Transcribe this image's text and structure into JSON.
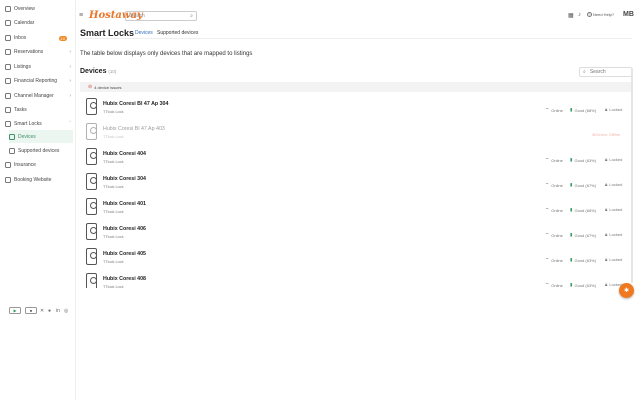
{
  "sidebar": {
    "items": [
      {
        "label": "Overview",
        "icon": "grid-icon"
      },
      {
        "label": "Calendar",
        "icon": "calendar-icon"
      },
      {
        "label": "Inbox",
        "icon": "inbox-icon",
        "badge": "10"
      },
      {
        "label": "Reservations",
        "icon": "reservations-icon"
      },
      {
        "label": "Listings",
        "icon": "listings-icon"
      },
      {
        "label": "Financial Reporting",
        "icon": "finance-icon"
      },
      {
        "label": "Channel Manager",
        "icon": "channel-icon"
      },
      {
        "label": "Tasks",
        "icon": "tasks-icon"
      },
      {
        "label": "Smart Locks",
        "icon": "lock-icon"
      },
      {
        "label": "Devices",
        "icon": "devices-icon"
      },
      {
        "label": "Supported devices",
        "icon": "supported-devices-icon"
      },
      {
        "label": "Insurance",
        "icon": "insurance-icon"
      },
      {
        "label": "Booking Website",
        "icon": "website-icon"
      }
    ],
    "store_badges": [
      "Google Play",
      "App Store"
    ],
    "social": [
      "twitter",
      "facebook",
      "linkedin",
      "instagram"
    ]
  },
  "topbar": {
    "logo": "Hostaway",
    "search_placeholder": "Search",
    "need_help": "Need Help?",
    "avatar": "MB"
  },
  "page": {
    "title": "Smart Locks",
    "tabs": [
      "Devices",
      "Supported devices"
    ],
    "intro": "The table below displays only devices that are mapped to listings",
    "devices_heading": "Devices",
    "devices_count": "(10)",
    "search_placeholder": "Search",
    "issues": "4 device issues"
  },
  "devices": [
    {
      "name": "Hubix Coresi Bl 47 Ap 304",
      "type": "TTlock Lock",
      "online": "Online",
      "signal": "Good (68%)",
      "lock": "Locked",
      "offline": false
    },
    {
      "name": "Hubix Coresi Bl 47 Ap 403",
      "type": "TTlock Lock",
      "offline": true,
      "offline_label": "Device Offline"
    },
    {
      "name": "Hubix Coresi 404",
      "type": "TTlock Lock",
      "online": "Online",
      "signal": "Good (63%)",
      "lock": "Locked",
      "offline": false
    },
    {
      "name": "Hubix Coresi 304",
      "type": "TTlock Lock",
      "online": "Online",
      "signal": "Good (67%)",
      "lock": "Locked",
      "offline": false
    },
    {
      "name": "Hubix Coresi 401",
      "type": "TTlock Lock",
      "online": "Online",
      "signal": "Good (68%)",
      "lock": "Locked",
      "offline": false
    },
    {
      "name": "Hubix Coresi 406",
      "type": "TTlock Lock",
      "online": "Online",
      "signal": "Good (67%)",
      "lock": "Locked",
      "offline": false
    },
    {
      "name": "Hubix Coresi 405",
      "type": "TTlock Lock",
      "online": "Online",
      "signal": "Good (63%)",
      "lock": "Locked",
      "offline": false
    },
    {
      "name": "Hubix Coresi 408",
      "type": "TTlock Lock",
      "online": "Online",
      "signal": "Good (63%)",
      "lock": "Locked",
      "offline": false
    }
  ],
  "colors": {
    "accent": "#2e6fb7",
    "brand": "#e8762b",
    "good": "#3a9b67",
    "offline": "#e25b4b"
  }
}
